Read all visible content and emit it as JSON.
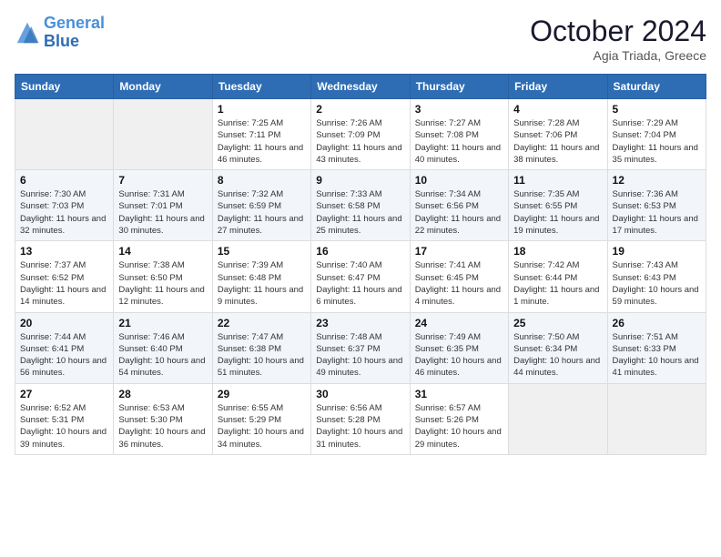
{
  "header": {
    "logo_line1": "General",
    "logo_line2": "Blue",
    "month": "October 2024",
    "location": "Agia Triada, Greece"
  },
  "weekdays": [
    "Sunday",
    "Monday",
    "Tuesday",
    "Wednesday",
    "Thursday",
    "Friday",
    "Saturday"
  ],
  "weeks": [
    [
      {
        "day": "",
        "info": ""
      },
      {
        "day": "",
        "info": ""
      },
      {
        "day": "1",
        "info": "Sunrise: 7:25 AM\nSunset: 7:11 PM\nDaylight: 11 hours and 46 minutes."
      },
      {
        "day": "2",
        "info": "Sunrise: 7:26 AM\nSunset: 7:09 PM\nDaylight: 11 hours and 43 minutes."
      },
      {
        "day": "3",
        "info": "Sunrise: 7:27 AM\nSunset: 7:08 PM\nDaylight: 11 hours and 40 minutes."
      },
      {
        "day": "4",
        "info": "Sunrise: 7:28 AM\nSunset: 7:06 PM\nDaylight: 11 hours and 38 minutes."
      },
      {
        "day": "5",
        "info": "Sunrise: 7:29 AM\nSunset: 7:04 PM\nDaylight: 11 hours and 35 minutes."
      }
    ],
    [
      {
        "day": "6",
        "info": "Sunrise: 7:30 AM\nSunset: 7:03 PM\nDaylight: 11 hours and 32 minutes."
      },
      {
        "day": "7",
        "info": "Sunrise: 7:31 AM\nSunset: 7:01 PM\nDaylight: 11 hours and 30 minutes."
      },
      {
        "day": "8",
        "info": "Sunrise: 7:32 AM\nSunset: 6:59 PM\nDaylight: 11 hours and 27 minutes."
      },
      {
        "day": "9",
        "info": "Sunrise: 7:33 AM\nSunset: 6:58 PM\nDaylight: 11 hours and 25 minutes."
      },
      {
        "day": "10",
        "info": "Sunrise: 7:34 AM\nSunset: 6:56 PM\nDaylight: 11 hours and 22 minutes."
      },
      {
        "day": "11",
        "info": "Sunrise: 7:35 AM\nSunset: 6:55 PM\nDaylight: 11 hours and 19 minutes."
      },
      {
        "day": "12",
        "info": "Sunrise: 7:36 AM\nSunset: 6:53 PM\nDaylight: 11 hours and 17 minutes."
      }
    ],
    [
      {
        "day": "13",
        "info": "Sunrise: 7:37 AM\nSunset: 6:52 PM\nDaylight: 11 hours and 14 minutes."
      },
      {
        "day": "14",
        "info": "Sunrise: 7:38 AM\nSunset: 6:50 PM\nDaylight: 11 hours and 12 minutes."
      },
      {
        "day": "15",
        "info": "Sunrise: 7:39 AM\nSunset: 6:48 PM\nDaylight: 11 hours and 9 minutes."
      },
      {
        "day": "16",
        "info": "Sunrise: 7:40 AM\nSunset: 6:47 PM\nDaylight: 11 hours and 6 minutes."
      },
      {
        "day": "17",
        "info": "Sunrise: 7:41 AM\nSunset: 6:45 PM\nDaylight: 11 hours and 4 minutes."
      },
      {
        "day": "18",
        "info": "Sunrise: 7:42 AM\nSunset: 6:44 PM\nDaylight: 11 hours and 1 minute."
      },
      {
        "day": "19",
        "info": "Sunrise: 7:43 AM\nSunset: 6:43 PM\nDaylight: 10 hours and 59 minutes."
      }
    ],
    [
      {
        "day": "20",
        "info": "Sunrise: 7:44 AM\nSunset: 6:41 PM\nDaylight: 10 hours and 56 minutes."
      },
      {
        "day": "21",
        "info": "Sunrise: 7:46 AM\nSunset: 6:40 PM\nDaylight: 10 hours and 54 minutes."
      },
      {
        "day": "22",
        "info": "Sunrise: 7:47 AM\nSunset: 6:38 PM\nDaylight: 10 hours and 51 minutes."
      },
      {
        "day": "23",
        "info": "Sunrise: 7:48 AM\nSunset: 6:37 PM\nDaylight: 10 hours and 49 minutes."
      },
      {
        "day": "24",
        "info": "Sunrise: 7:49 AM\nSunset: 6:35 PM\nDaylight: 10 hours and 46 minutes."
      },
      {
        "day": "25",
        "info": "Sunrise: 7:50 AM\nSunset: 6:34 PM\nDaylight: 10 hours and 44 minutes."
      },
      {
        "day": "26",
        "info": "Sunrise: 7:51 AM\nSunset: 6:33 PM\nDaylight: 10 hours and 41 minutes."
      }
    ],
    [
      {
        "day": "27",
        "info": "Sunrise: 6:52 AM\nSunset: 5:31 PM\nDaylight: 10 hours and 39 minutes."
      },
      {
        "day": "28",
        "info": "Sunrise: 6:53 AM\nSunset: 5:30 PM\nDaylight: 10 hours and 36 minutes."
      },
      {
        "day": "29",
        "info": "Sunrise: 6:55 AM\nSunset: 5:29 PM\nDaylight: 10 hours and 34 minutes."
      },
      {
        "day": "30",
        "info": "Sunrise: 6:56 AM\nSunset: 5:28 PM\nDaylight: 10 hours and 31 minutes."
      },
      {
        "day": "31",
        "info": "Sunrise: 6:57 AM\nSunset: 5:26 PM\nDaylight: 10 hours and 29 minutes."
      },
      {
        "day": "",
        "info": ""
      },
      {
        "day": "",
        "info": ""
      }
    ]
  ]
}
